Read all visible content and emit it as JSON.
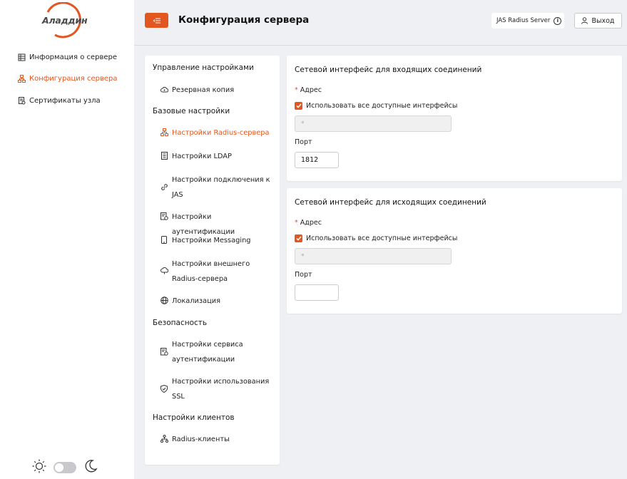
{
  "brand": {
    "logo_text": "Аладдин",
    "accent": "#e2561f"
  },
  "sidebar": {
    "items": [
      {
        "label": "Информация о сервере",
        "icon": "server-info-icon",
        "active": false
      },
      {
        "label": "Конфигурация сервера",
        "icon": "network-config-icon",
        "active": true
      },
      {
        "label": "Сертификаты узла",
        "icon": "certificate-icon",
        "active": false
      }
    ],
    "theme": {
      "light_icon": "sun-icon",
      "dark_icon": "moon-icon",
      "dark_enabled": false
    }
  },
  "header": {
    "title": "Конфигурация сервера",
    "server_name": "JAS Radius Server",
    "logout_label": "Выход"
  },
  "settings_tree": {
    "groups": [
      {
        "title": "Управление настройками",
        "items": [
          {
            "label": "Резервная копия",
            "icon": "cloud-backup-icon",
            "active": false
          }
        ]
      },
      {
        "title": "Базовые настройки",
        "items": [
          {
            "label": "Настройки Radius-сервера",
            "icon": "network-icon",
            "active": true
          },
          {
            "label": "Настройки LDAP",
            "icon": "book-icon",
            "active": false
          },
          {
            "label": "Настройки подключения к JAS",
            "icon": "link-icon",
            "active": false
          },
          {
            "label": "Настройки аутентификации",
            "icon": "auth-doc-icon",
            "active": false
          },
          {
            "label": "Настройки Messaging",
            "icon": "phone-icon",
            "active": false
          },
          {
            "label": "Настройки внешнего Radius-сервера",
            "icon": "cloud-server-icon",
            "active": false
          },
          {
            "label": "Локализация",
            "icon": "globe-icon",
            "active": false
          }
        ]
      },
      {
        "title": "Безопасность",
        "items": [
          {
            "label": "Настройки сервиса аутентификации",
            "icon": "auth-doc-icon",
            "active": false
          },
          {
            "label": "Настройки использования SSL",
            "icon": "shield-icon",
            "active": false
          }
        ]
      },
      {
        "title": "Настройки клиентов",
        "items": [
          {
            "label": "Radius-клиенты",
            "icon": "clients-icon",
            "active": false
          }
        ]
      }
    ]
  },
  "incoming": {
    "title": "Сетевой интерфейс для входящих соединений",
    "address_label": "Адрес",
    "required_mark": "*",
    "use_all_label": "Использовать все доступные интерфейсы",
    "use_all_checked": true,
    "address_value": "*",
    "port_label": "Порт",
    "port_value": "1812"
  },
  "outgoing": {
    "title": "Сетевой интерфейс для исходящих соединений",
    "address_label": "Адрес",
    "required_mark": "*",
    "use_all_label": "Использовать все доступные интерфейсы",
    "use_all_checked": true,
    "address_value": "*",
    "port_label": "Порт",
    "port_value": ""
  }
}
